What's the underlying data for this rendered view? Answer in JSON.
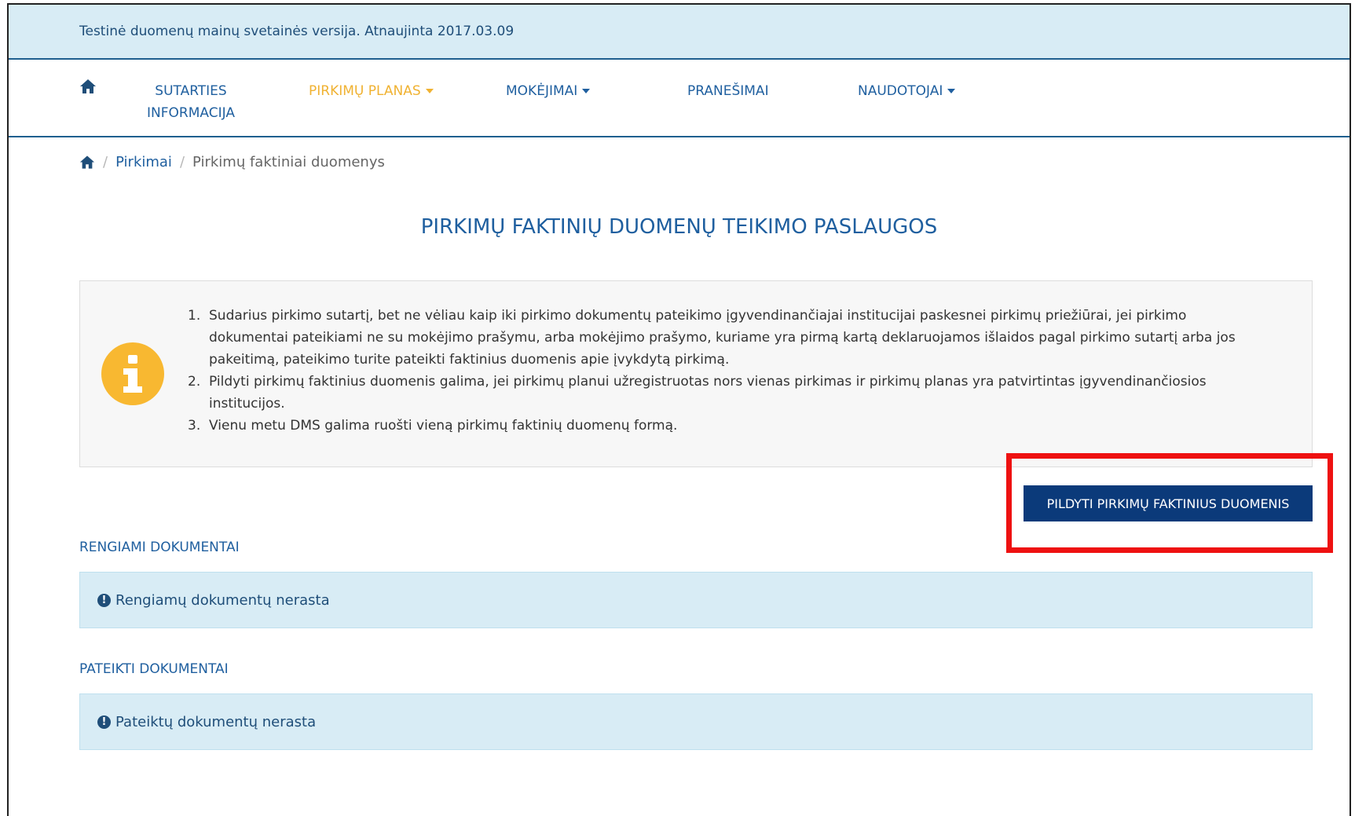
{
  "topbar": {
    "text": "Testinė duomenų mainų svetainės versija. Atnaujinta 2017.03.09"
  },
  "nav": {
    "home_icon": "home-icon",
    "items": [
      {
        "label_line1": "SUTARTIES",
        "label_line2": "INFORMACIJA",
        "dropdown": false,
        "active": false
      },
      {
        "label_line1": "PIRKIMŲ PLANAS",
        "label_line2": "",
        "dropdown": true,
        "active": true
      },
      {
        "label_line1": "MOKĖJIMAI",
        "label_line2": "",
        "dropdown": true,
        "active": false
      },
      {
        "label_line1": "PRANEŠIMAI",
        "label_line2": "",
        "dropdown": false,
        "active": false
      },
      {
        "label_line1": "NAUDOTOJAI",
        "label_line2": "",
        "dropdown": true,
        "active": false
      }
    ],
    "active_color": "#f0b232",
    "link_color": "#1f5f9f"
  },
  "breadcrumb": {
    "separator": "/",
    "link": "Pirkimai",
    "current": "Pirkimų faktiniai duomenys"
  },
  "page": {
    "title": "PIRKIMŲ FAKTINIŲ DUOMENŲ TEIKIMO PASLAUGOS"
  },
  "info": {
    "icon": "info-icon",
    "items": [
      {
        "num": "1.",
        "lines": [
          "Sudarius pirkimo sutartį, bet ne vėliau kaip iki pirkimo dokumentų pateikimo įgyvendinančiajai institucijai paskesnei pirkimų priežiūrai, jei pirkimo",
          "dokumentai pateikiami ne su mokėjimo prašymu, arba mokėjimo prašymo, kuriame yra pirmą kartą deklaruojamos išlaidos pagal pirkimo sutartį arba jos",
          "pakeitimą, pateikimo turite pateikti faktinius duomenis apie įvykdytą pirkimą."
        ]
      },
      {
        "num": "2.",
        "lines": [
          "Pildyti pirkimų faktinius duomenis galima, jei pirkimų planui užregistruotas nors vienas pirkimas ir pirkimų planas yra patvirtintas įgyvendinančiosios",
          "institucijos."
        ]
      },
      {
        "num": "3.",
        "lines": [
          "Vienu metu DMS galima ruošti vieną pirkimų faktinių duomenų formą."
        ]
      }
    ]
  },
  "actions": {
    "fill_button": "PILDYTI PIRKIMŲ FAKTINIUS DUOMENIS",
    "highlight_color": "#ee1111",
    "button_color": "#0b3a7a"
  },
  "sections": {
    "draft": {
      "heading": "RENGIAMI DOKUMENTAI",
      "empty_text": "Rengiamų dokumentų nerasta"
    },
    "submitted": {
      "heading": "PATEIKTI DOKUMENTAI",
      "empty_text": "Pateiktų dokumentų nerasta"
    },
    "alert_icon": "exclamation-circle-icon",
    "alert_glyph": "!"
  }
}
